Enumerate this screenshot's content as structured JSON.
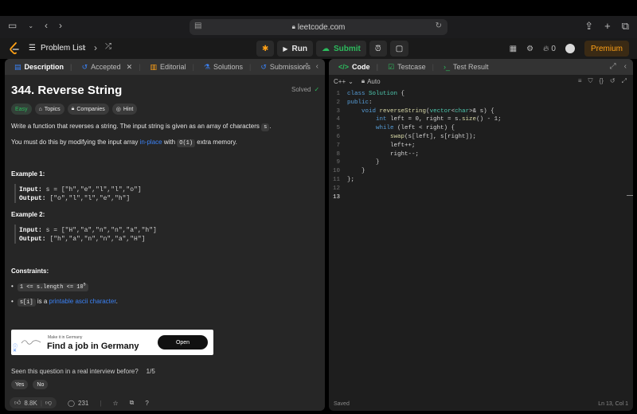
{
  "browser": {
    "url": "leetcode.com"
  },
  "navbar": {
    "problem_list": "Problem List",
    "run": "Run",
    "submit": "Submit",
    "fire_count": "0",
    "premium": "Premium"
  },
  "left_tabs": [
    {
      "label": "Description"
    },
    {
      "label": "Accepted"
    },
    {
      "label": "Editorial"
    },
    {
      "label": "Solutions"
    },
    {
      "label": "Submissions"
    }
  ],
  "problem": {
    "title": "344. Reverse String",
    "status": "Solved",
    "chips": {
      "easy": "Easy",
      "topics": "Topics",
      "companies": "Companies",
      "hint": "Hint"
    },
    "desc1_pre": "Write a function that reverses a string. The input string is given as an array of characters ",
    "desc1_code": "s",
    "desc1_post": ".",
    "desc2_pre": "You must do this by modifying the input array ",
    "desc2_link": "in-place",
    "desc2_mid": " with ",
    "desc2_code": "O(1)",
    "desc2_post": " extra memory.",
    "example1_title": "Example 1:",
    "example1_input_label": "Input:",
    "example1_input": " s = [\"h\",\"e\",\"l\",\"l\",\"o\"]",
    "example1_output_label": "Output:",
    "example1_output": " [\"o\",\"l\",\"l\",\"e\",\"h\"]",
    "example2_title": "Example 2:",
    "example2_input_label": "Input:",
    "example2_input": " s = [\"H\",\"a\",\"n\",\"n\",\"a\",\"h\"]",
    "example2_output_label": "Output:",
    "example2_output": " [\"h\",\"a\",\"n\",\"n\",\"a\",\"H\"]",
    "constraints_title": "Constraints:",
    "constraint1_code": "1 <= s.length <= 10",
    "constraint1_sup": "5",
    "constraint2_code": "s[i]",
    "constraint2_mid": " is a ",
    "constraint2_link": "printable ascii character",
    "constraint2_post": "."
  },
  "ad": {
    "small": "Make it in Germany",
    "big": "Find a job in Germany",
    "button": "Open"
  },
  "interview": {
    "question": "Seen this question in a real interview before?",
    "count": "1/5",
    "yes": "Yes",
    "no": "No"
  },
  "footer": {
    "likes": "8.8K",
    "comments": "231"
  },
  "right_tabs": [
    {
      "label": "Code"
    },
    {
      "label": "Testcase"
    },
    {
      "label": "Test Result"
    }
  ],
  "editor": {
    "language": "C++",
    "mode": "Auto",
    "status_left": "Saved",
    "status_right": "Ln 13, Col 1"
  },
  "code_lines": [
    "class Solution {",
    "public:",
    "    void reverseString(vector<char>& s) {",
    "        int left = 0, right = s.size() - 1;",
    "        while (left < right) {",
    "            swap(s[left], s[right]);",
    "            left++;",
    "            right--;",
    "        }",
    "    }",
    "};",
    "",
    ""
  ],
  "colors": {
    "accent_green": "#2cbb5d",
    "premium_orange": "#ffa116",
    "link_blue": "#3b82f6"
  }
}
